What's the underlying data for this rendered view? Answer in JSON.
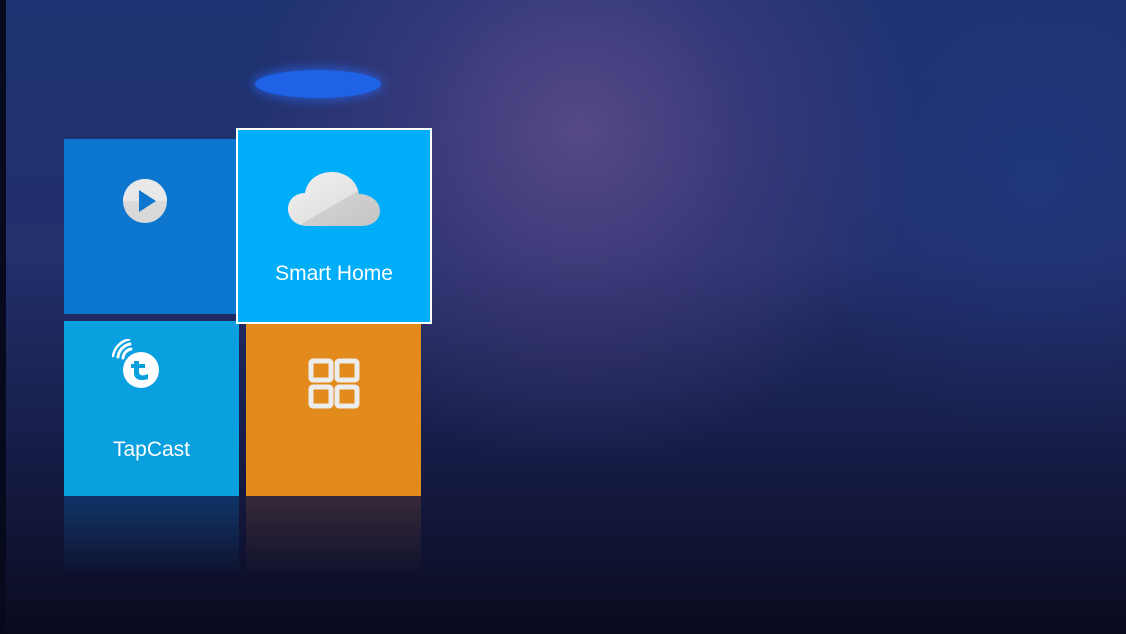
{
  "screen": {
    "colors": {
      "background_top": "#1d3270",
      "background_bottom": "#0a0b1f",
      "focus_glow": "#1f62e6"
    }
  },
  "tiles": [
    {
      "id": "video",
      "label": "",
      "icon": "play-icon",
      "color": "#0d77d0",
      "focused": false
    },
    {
      "id": "smart_home",
      "label": "Smart Home",
      "icon": "cloud-icon",
      "color": "#00adf8",
      "focused": true
    },
    {
      "id": "tapcast",
      "label": "TapCast",
      "icon": "tapcast-icon",
      "color": "#0aa0df",
      "focused": false
    },
    {
      "id": "apps",
      "label": "",
      "icon": "app-grid-icon",
      "color": "#e38a1c",
      "focused": false
    }
  ]
}
